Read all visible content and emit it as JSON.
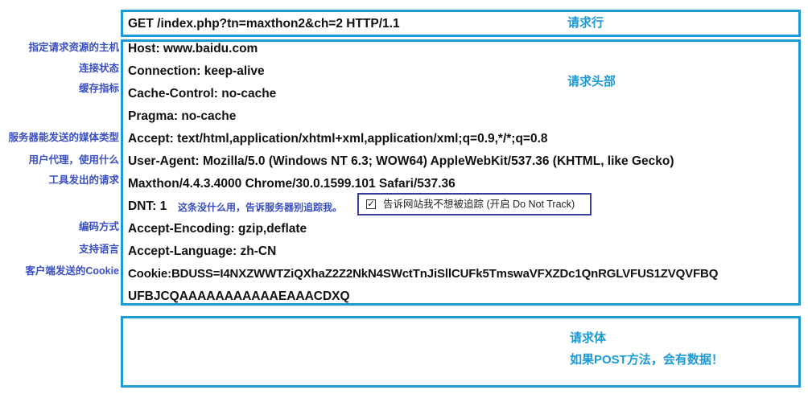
{
  "request_line": {
    "text": "GET /index.php?tn=maxthon2&ch=2 HTTP/1.1",
    "label": "请求行"
  },
  "request_headers": {
    "label": "请求头部",
    "lines": [
      "Host: www.baidu.com",
      "Connection: keep-alive",
      "Cache-Control: no-cache",
      "Pragma: no-cache",
      "Accept: text/html,application/xhtml+xml,application/xml;q=0.9,*/*;q=0.8",
      "User-Agent: Mozilla/5.0 (Windows NT 6.3; WOW64) AppleWebKit/537.36 (KHTML, like Gecko)",
      "Maxthon/4.4.3.4000 Chrome/30.0.1599.101 Safari/537.36",
      "DNT: 1",
      "Accept-Encoding: gzip,deflate",
      "Accept-Language: zh-CN",
      "Cookie:BDUSS=I4NXZWWTZiQXhaZ2Z2NkN4SWctTnJiSllCUFk5TmswaVFXZDc1QnRGLVFUS1ZVQVFBQ",
      "UFBJCQAAAAAAAAAAAEAAACDXQ"
    ]
  },
  "annotations": {
    "host": "指定请求资源的主机",
    "connection": "连接状态",
    "cache": "缓存指标",
    "accept": "服务器能发送的媒体类型",
    "user_agent_1": "用户代理，使用什么",
    "user_agent_2": "工具发出的请求",
    "encoding": "编码方式",
    "language": "支持语言",
    "cookie": "客户端发送的Cookie"
  },
  "dnt_note": "这条没什么用，告诉服务器别追踪我。",
  "dnt_checkbox": {
    "label": "告诉网站我不想被追踪 (开启 Do Not Track)",
    "checked": true
  },
  "request_body": {
    "label": "请求体",
    "note": "如果POST方法，会有数据！"
  },
  "colors": {
    "box_border": "#1b9ad6",
    "annotation": "#3a4fc2",
    "checkbox_border": "#3b3f9a"
  }
}
